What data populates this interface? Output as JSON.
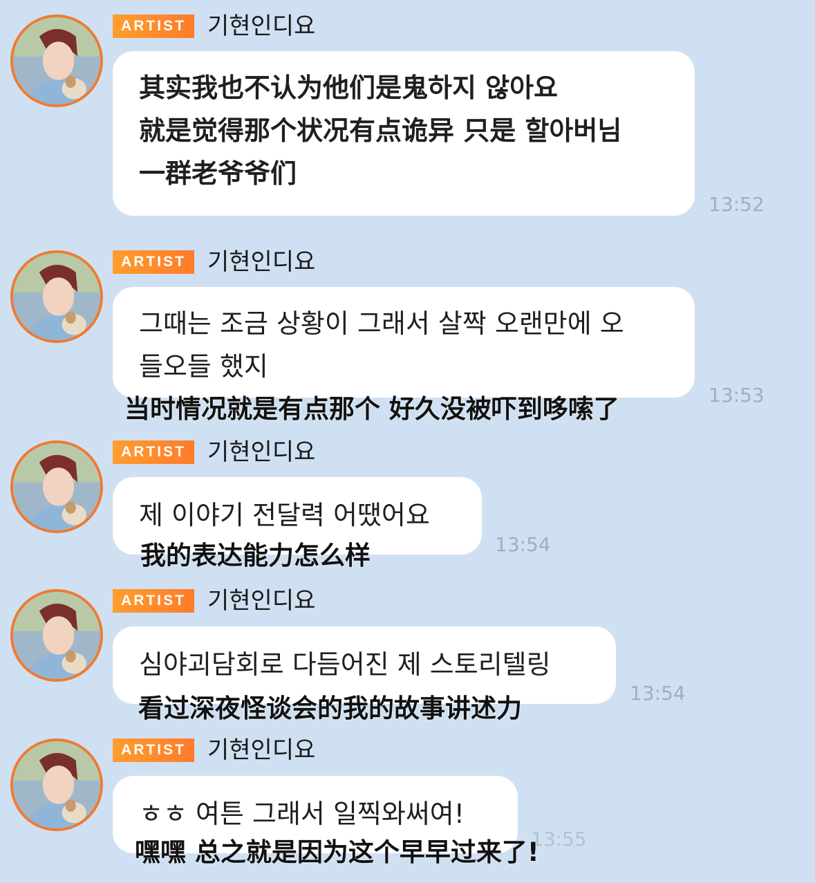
{
  "sender": {
    "badge": "ARTIST",
    "name": "기현인디요"
  },
  "messages": [
    {
      "lines": [
        "其实我也不认为他们是鬼하지 않아요",
        "就是觉得那个状况有点诡异 只是 할아버님",
        "一群老爷爷们"
      ],
      "time": "13:52"
    },
    {
      "lines": [
        "그때는 조금 상황이 그래서 살짝 오랜만에 오",
        "들오들 했지"
      ],
      "subtitle": "当时情况就是有点那个 好久没被吓到哆嗦了",
      "time": "13:53"
    },
    {
      "lines": [
        "제 이야기 전달력 어땠어요"
      ],
      "subtitle": "我的表达能力怎么样",
      "time": "13:54"
    },
    {
      "lines": [
        "심야괴담회로 다듬어진 제 스토리텔링"
      ],
      "subtitle": "看过深夜怪谈会的我的故事讲述力",
      "time": "13:54"
    },
    {
      "lines": [
        "ㅎㅎ 여튼 그래서 일찍와써여!"
      ],
      "subtitle": "嘿嘿 总之就是因为这个早早过来了!",
      "time": "13:55"
    }
  ],
  "colors": {
    "background": "#cfe0f2",
    "badge": "#ff8a2c",
    "avatar_ring": "#f07a30",
    "bubble": "#ffffff",
    "time": "#9eafc2"
  },
  "icons": {
    "avatar": "profile-photo"
  }
}
